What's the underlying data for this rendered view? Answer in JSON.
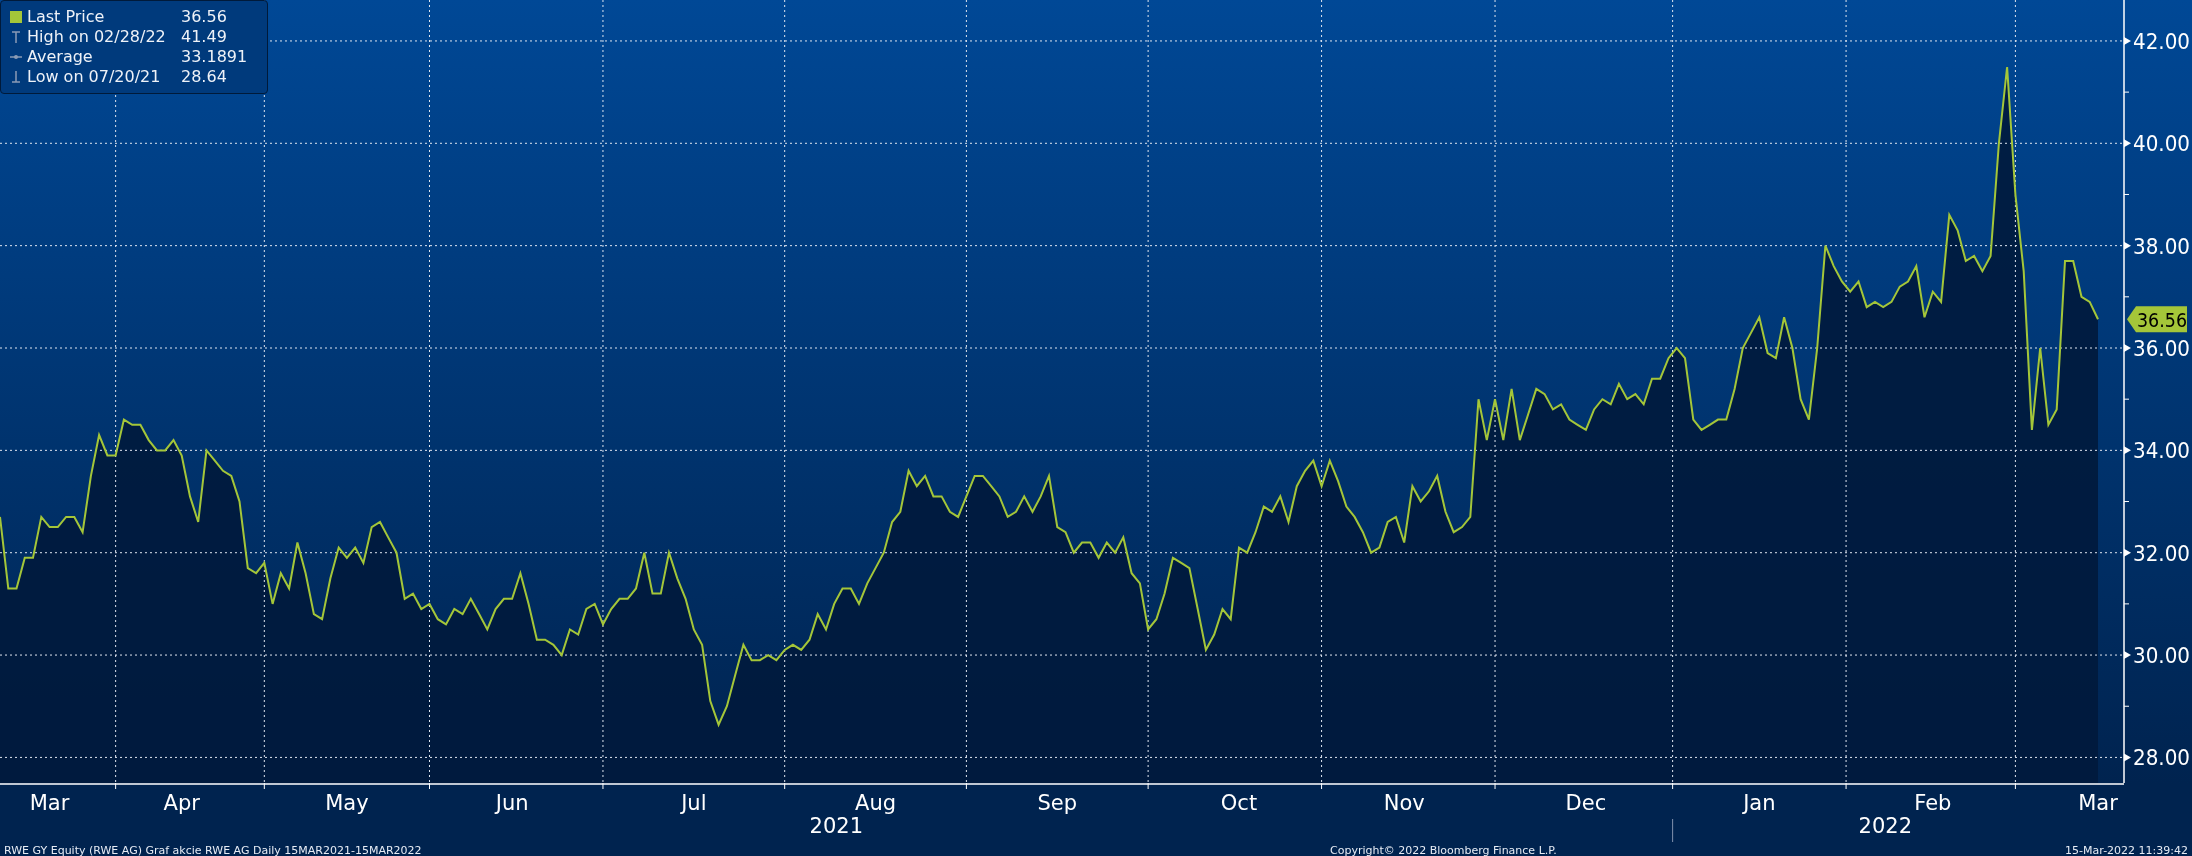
{
  "legend": {
    "items": [
      {
        "kind": "series",
        "value": "36.56"
      },
      {
        "kind": "high",
        "label": "High on 02/28/22",
        "value": "41.49"
      },
      {
        "kind": "average",
        "label": "Average",
        "value": "33.1891"
      },
      {
        "kind": "low",
        "label": "Low on 07/20/21",
        "value": "28.64"
      }
    ]
  },
  "chart": {
    "last_price_tag": "36.56",
    "year_labels": [
      "2021",
      "2022"
    ],
    "chart_data": {
      "type": "line",
      "grid": true,
      "ylim": [
        27.5,
        42.8
      ],
      "yticks": [
        {
          "value": 28,
          "label": "28.00"
        },
        {
          "value": 30,
          "label": "30.00"
        },
        {
          "value": 32,
          "label": "32.00"
        },
        {
          "value": 34,
          "label": "34.00"
        },
        {
          "value": 36,
          "label": "36.00"
        },
        {
          "value": 38,
          "label": "38.00"
        },
        {
          "value": 40,
          "label": "40.00"
        },
        {
          "value": 42,
          "label": "42.00"
        }
      ],
      "categories": [
        null,
        null,
        null,
        null,
        null,
        null,
        "Mar",
        null,
        null,
        null,
        null,
        null,
        null,
        null,
        null,
        null,
        null,
        null,
        null,
        null,
        null,
        null,
        "Apr",
        null,
        null,
        null,
        null,
        null,
        null,
        null,
        null,
        null,
        null,
        null,
        null,
        null,
        null,
        null,
        null,
        null,
        null,
        null,
        "May",
        null,
        null,
        null,
        null,
        null,
        null,
        null,
        null,
        null,
        null,
        null,
        null,
        null,
        null,
        null,
        null,
        null,
        null,
        null,
        "Jun",
        null,
        null,
        null,
        null,
        null,
        null,
        null,
        null,
        null,
        null,
        null,
        null,
        null,
        null,
        null,
        null,
        null,
        null,
        null,
        null,
        null,
        "Jul",
        null,
        null,
        null,
        null,
        null,
        null,
        null,
        null,
        null,
        null,
        null,
        null,
        null,
        null,
        null,
        null,
        null,
        null,
        null,
        null,
        null,
        "Aug",
        null,
        null,
        null,
        null,
        null,
        null,
        null,
        null,
        null,
        null,
        null,
        null,
        null,
        null,
        null,
        null,
        null,
        null,
        null,
        null,
        null,
        "Sep",
        null,
        null,
        null,
        null,
        null,
        null,
        null,
        null,
        null,
        null,
        null,
        null,
        null,
        null,
        null,
        null,
        null,
        null,
        null,
        null,
        null,
        "Oct",
        null,
        null,
        null,
        null,
        null,
        null,
        null,
        null,
        null,
        null,
        null,
        null,
        null,
        null,
        null,
        null,
        null,
        null,
        null,
        "Nov",
        null,
        null,
        null,
        null,
        null,
        null,
        null,
        null,
        null,
        null,
        null,
        null,
        null,
        null,
        null,
        null,
        null,
        null,
        null,
        null,
        null,
        "Dec",
        null,
        null,
        null,
        null,
        null,
        null,
        null,
        null,
        null,
        null,
        null,
        null,
        null,
        null,
        null,
        null,
        null,
        null,
        null,
        null,
        "Jan",
        null,
        null,
        null,
        null,
        null,
        null,
        null,
        null,
        null,
        null,
        null,
        null,
        null,
        null,
        null,
        null,
        null,
        null,
        null,
        null,
        "Feb",
        null,
        null,
        null,
        null,
        null,
        null,
        null,
        null,
        null,
        null,
        null,
        null,
        null,
        null,
        null,
        null,
        null,
        null,
        null,
        "Mar"
      ],
      "series": [
        {
          "name": "Last Price",
          "color": "#a4c639",
          "values": [
            32.7,
            31.3,
            31.3,
            31.9,
            31.9,
            32.7,
            32.5,
            32.5,
            32.7,
            32.7,
            32.4,
            33.5,
            34.3,
            33.9,
            33.9,
            34.6,
            34.5,
            34.5,
            34.2,
            34.0,
            34.0,
            34.2,
            33.9,
            33.1,
            32.6,
            34.0,
            33.8,
            33.6,
            33.5,
            33.0,
            31.7,
            31.6,
            31.8,
            31.0,
            31.6,
            31.3,
            32.2,
            31.6,
            30.8,
            30.7,
            31.5,
            32.1,
            31.9,
            32.1,
            31.8,
            32.5,
            32.6,
            32.3,
            32.0,
            31.1,
            31.2,
            30.9,
            31.0,
            30.7,
            30.6,
            30.9,
            30.8,
            31.1,
            30.8,
            30.5,
            30.9,
            31.1,
            31.1,
            31.6,
            31.0,
            30.3,
            30.3,
            30.2,
            30.0,
            30.5,
            30.4,
            30.9,
            31.0,
            30.6,
            30.9,
            31.1,
            31.1,
            31.3,
            32.0,
            31.2,
            31.2,
            32.0,
            31.5,
            31.1,
            30.5,
            30.2,
            29.1,
            28.64,
            29.0,
            29.6,
            30.2,
            29.9,
            29.9,
            30.0,
            29.9,
            30.1,
            30.2,
            30.1,
            30.3,
            30.8,
            30.5,
            31.0,
            31.3,
            31.3,
            31.0,
            31.4,
            31.7,
            32.0,
            32.6,
            32.8,
            33.6,
            33.3,
            33.5,
            33.1,
            33.1,
            32.8,
            32.7,
            33.1,
            33.5,
            33.5,
            33.3,
            33.1,
            32.7,
            32.8,
            33.1,
            32.8,
            33.1,
            33.5,
            32.5,
            32.4,
            32.0,
            32.2,
            32.2,
            31.9,
            32.2,
            32.0,
            32.3,
            31.6,
            31.4,
            30.5,
            30.7,
            31.2,
            31.9,
            31.8,
            31.7,
            30.9,
            30.1,
            30.4,
            30.9,
            30.7,
            32.1,
            32.0,
            32.4,
            32.9,
            32.8,
            33.1,
            32.6,
            33.3,
            33.6,
            33.8,
            33.3,
            33.8,
            33.4,
            32.9,
            32.7,
            32.4,
            32.0,
            32.1,
            32.6,
            32.7,
            32.2,
            33.3,
            33.0,
            33.2,
            33.5,
            32.8,
            32.4,
            32.5,
            32.7,
            35.0,
            34.2,
            35.0,
            34.2,
            35.2,
            34.2,
            34.7,
            35.2,
            35.1,
            34.8,
            34.9,
            34.6,
            34.5,
            34.4,
            34.8,
            35.0,
            34.9,
            35.3,
            35.0,
            35.1,
            34.9,
            35.4,
            35.4,
            35.8,
            36.0,
            35.8,
            34.6,
            34.4,
            34.5,
            34.6,
            34.6,
            35.2,
            36.0,
            36.3,
            36.6,
            35.9,
            35.8,
            36.6,
            36.0,
            35.0,
            34.6,
            36.0,
            38.0,
            37.6,
            37.3,
            37.1,
            37.3,
            36.8,
            36.9,
            36.8,
            36.9,
            37.2,
            37.3,
            37.6,
            36.6,
            37.1,
            36.9,
            38.6,
            38.3,
            37.7,
            37.8,
            37.5,
            37.8,
            40.0,
            41.49,
            39.0,
            37.5,
            34.4,
            36.0,
            34.5,
            34.8,
            37.7,
            37.7,
            37.0,
            36.9,
            36.56
          ]
        }
      ]
    }
  },
  "footer": {
    "left": "RWE GY Equity (RWE AG) Graf akcie RWE AG  Daily 15MAR2021-15MAR2022",
    "center": "Copyright© 2022 Bloomberg Finance L.P.",
    "right": "15-Mar-2022 11:39:42"
  }
}
